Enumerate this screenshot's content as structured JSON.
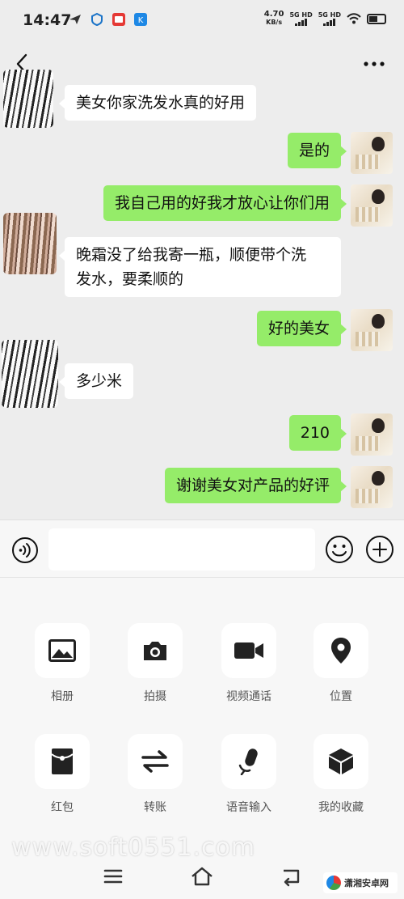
{
  "status_bar": {
    "time": "14:47",
    "net_speed_value": "4.70",
    "net_speed_unit": "KB/s",
    "sim1_label": "5G HD",
    "sim2_label": "5G HD",
    "icons": [
      "send-icon",
      "shield-icon",
      "app-red-icon",
      "app-blue-icon",
      "wifi-icon",
      "battery-icon"
    ]
  },
  "header": {
    "back_icon": "chevron-left-icon",
    "more_icon": "more-icon"
  },
  "messages": [
    {
      "side": "left",
      "text": "美女你家洗发水真的好用"
    },
    {
      "side": "right",
      "text": "是的"
    },
    {
      "side": "right",
      "text": "我自己用的好我才放心让你们用"
    },
    {
      "side": "left",
      "text": "晚霜没了给我寄一瓶，顺便带个洗发水，要柔顺的"
    },
    {
      "side": "right",
      "text": "好的美女"
    },
    {
      "side": "left",
      "text": "多少米"
    },
    {
      "side": "right",
      "text": "210"
    },
    {
      "side": "right",
      "text": "谢谢美女对产品的好评"
    }
  ],
  "messages_display": {
    "m3_line1": "晚霜没了给我寄一瓶，顺便带个洗",
    "m3_line2": "发水，要柔顺的"
  },
  "input_bar": {
    "voice_icon": "voice-icon",
    "input_value": "",
    "emoji_icon": "emoji-icon",
    "plus_icon": "plus-icon"
  },
  "panel": {
    "items": [
      {
        "label": "相册",
        "icon": "image-icon"
      },
      {
        "label": "拍摄",
        "icon": "camera-icon"
      },
      {
        "label": "视频通话",
        "icon": "video-icon"
      },
      {
        "label": "位置",
        "icon": "location-icon"
      },
      {
        "label": "红包",
        "icon": "red-packet-icon"
      },
      {
        "label": "转账",
        "icon": "transfer-icon"
      },
      {
        "label": "语音输入",
        "icon": "microphone-icon"
      },
      {
        "label": "我的收藏",
        "icon": "cube-icon"
      }
    ]
  },
  "nav_bar": {
    "icons": [
      "menu-icon",
      "home-icon",
      "back-icon"
    ]
  },
  "watermark": "www.soft0551.com",
  "brand_logo_text": "潇湘安卓网"
}
